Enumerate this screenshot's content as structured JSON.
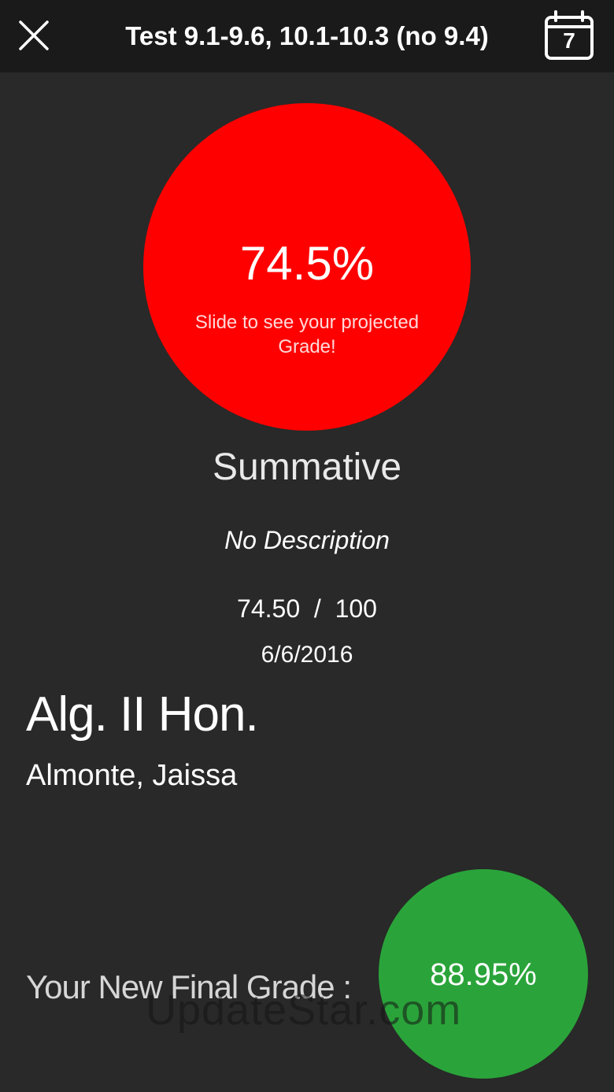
{
  "header": {
    "title": "Test 9.1-9.6, 10.1-10.3 (no 9.4)",
    "close_icon": "close-icon",
    "calendar_icon": "calendar-icon",
    "calendar_day": "7"
  },
  "grade": {
    "percent": "74.5%",
    "hint": "Slide to see your projected Grade!",
    "circle_color": "#ff0000"
  },
  "assignment": {
    "category": "Summative",
    "description": "No Description",
    "score": "74.50  /  100",
    "date": "6/6/2016"
  },
  "course": {
    "name": "Alg. II Hon.",
    "student": "Almonte, Jaissa"
  },
  "final": {
    "label": "Your New Final Grade :",
    "percent": "88.95%",
    "circle_color": "#2aa43a"
  },
  "watermark": "UpdateStar.com",
  "colors": {
    "background": "#282928",
    "topbar": "#1a1a1a"
  }
}
